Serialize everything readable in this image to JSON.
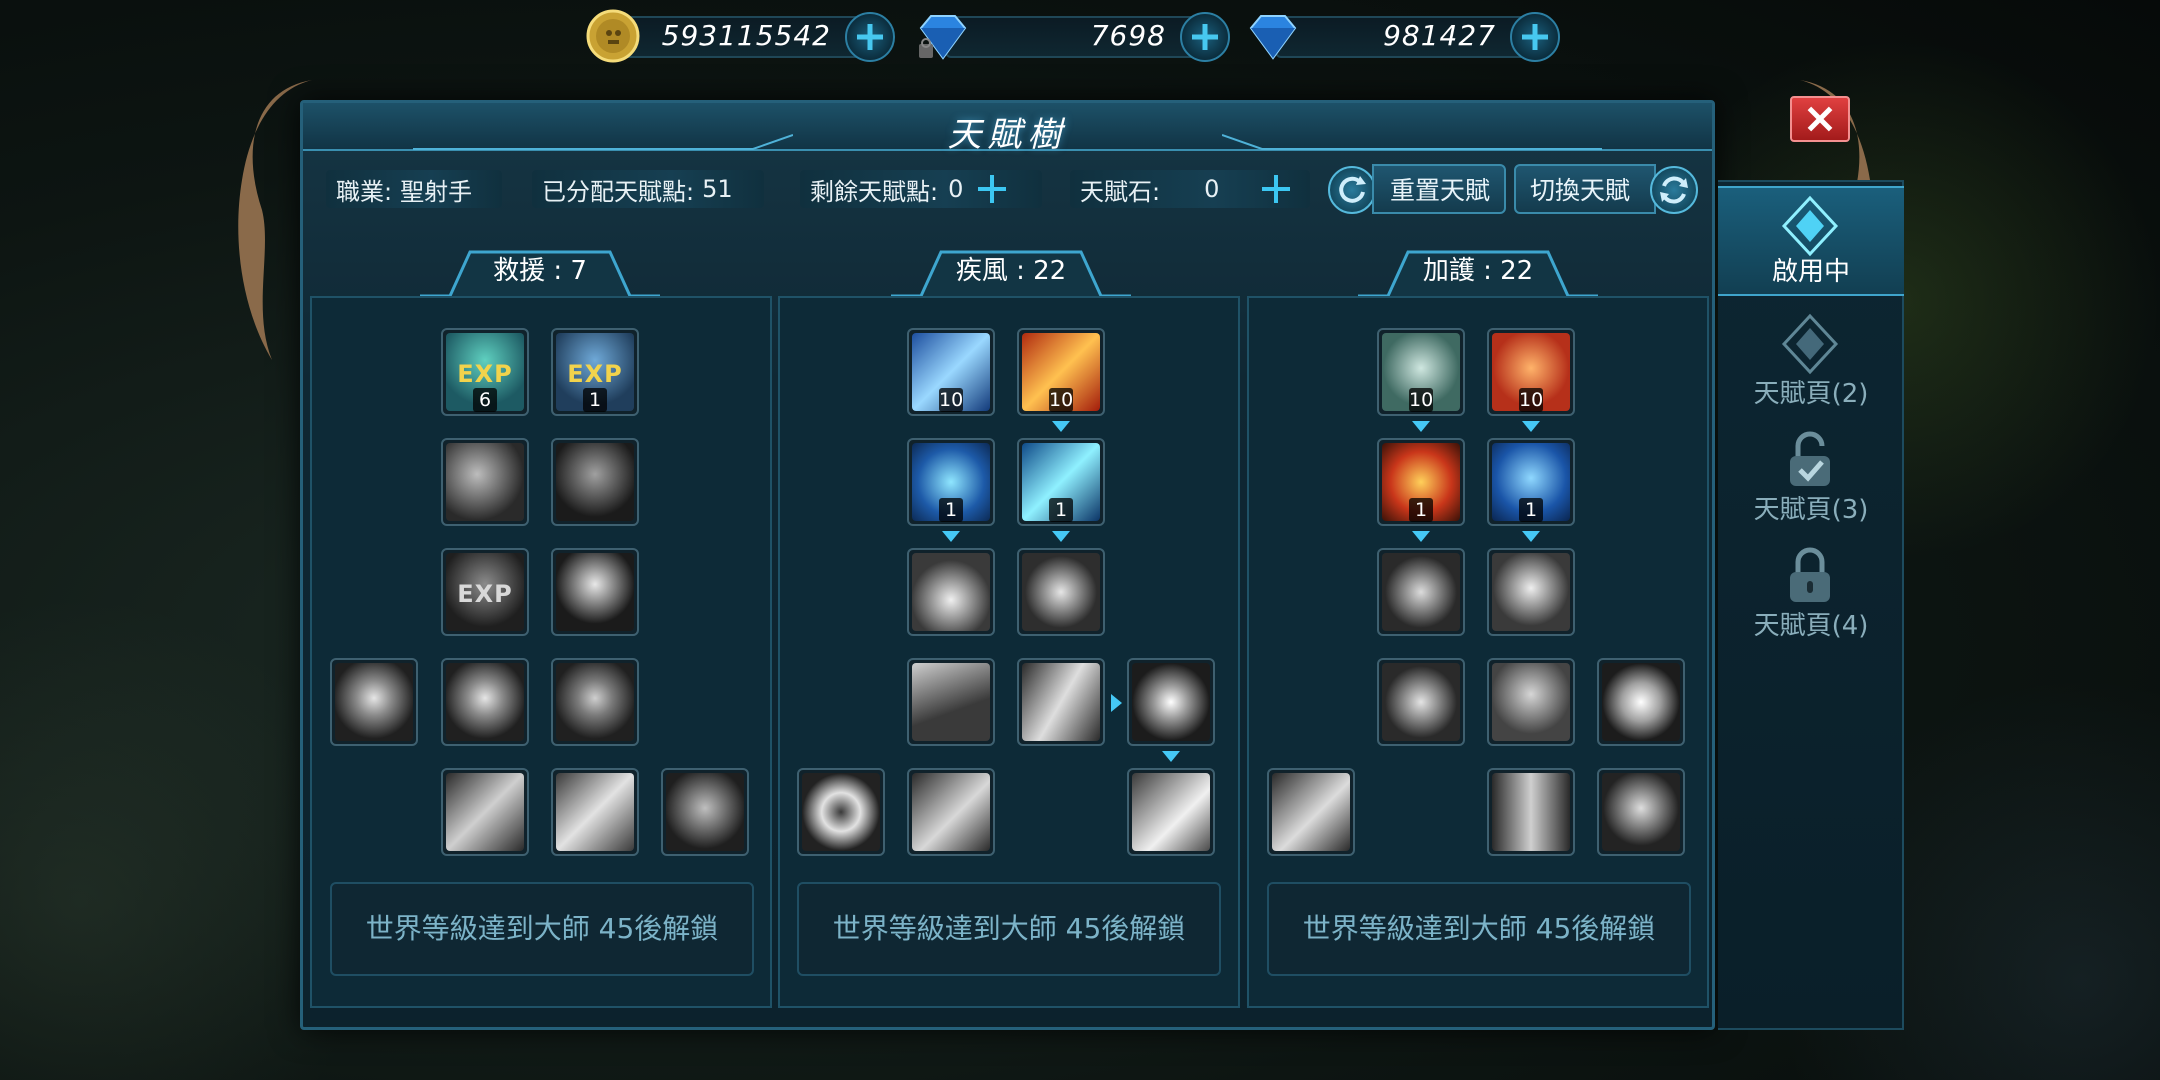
{
  "currency": {
    "gold": "593115542",
    "bound_diamond": "7698",
    "diamond": "981427"
  },
  "window": {
    "title": "天賦樹"
  },
  "info": {
    "class_label": "職業:",
    "class_value": "聖射手",
    "allocated_label": "已分配天賦點:",
    "allocated_value": "51",
    "remaining_label": "剩餘天賦點:",
    "remaining_value": "0",
    "stone_label": "天賦石:",
    "stone_value": "0",
    "reset_label": "重置天賦",
    "switch_label": "切換天賦"
  },
  "columns": [
    {
      "name": "救援",
      "points": "7",
      "header": "救援 : 7"
    },
    {
      "name": "疾風",
      "points": "22",
      "header": "疾風 : 22"
    },
    {
      "name": "加護",
      "points": "22",
      "header": "加護 : 22"
    }
  ],
  "skills": {
    "rescue_exp1_level": "6",
    "rescue_exp2_level": "1",
    "rescue_exp_text": "EXP",
    "wind_1_level": "10",
    "wind_2_level": "10",
    "wind_3_level": "1",
    "wind_4_level": "1",
    "guard_1_level": "10",
    "guard_2_level": "10",
    "guard_3_level": "1",
    "guard_4_level": "1"
  },
  "unlock_text": "世界等級達到大師  45後解鎖",
  "side_tabs": [
    {
      "label": "啟用中",
      "active": true
    },
    {
      "label": "天賦頁(2)",
      "active": false
    },
    {
      "label": "天賦頁(3)",
      "active": false
    },
    {
      "label": "天賦頁(4)",
      "active": false
    }
  ],
  "colors": {
    "accent": "#45c8f5",
    "close_red": "#d83131",
    "panel_bg": "#0d2a37"
  }
}
